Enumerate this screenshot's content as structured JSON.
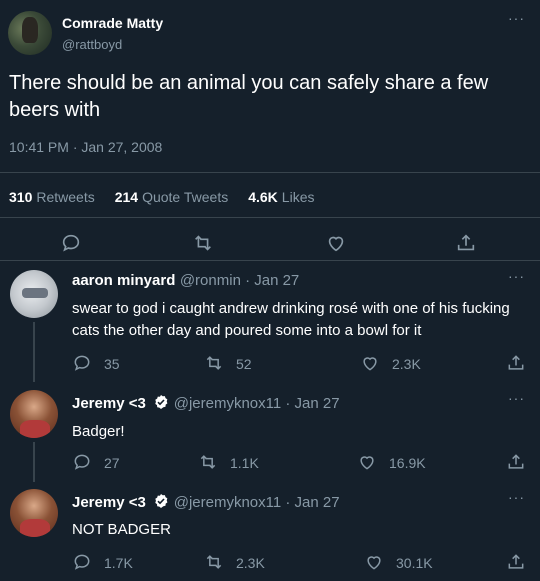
{
  "tweet": {
    "author_name": "Comrade Matty",
    "author_handle": "@rattboyd",
    "more_label": "···",
    "text": "There should be an animal you can safely share a few beers with",
    "timestamp": "10:41 PM · Jan 27, 2008",
    "stats": {
      "retweets_count": "310",
      "retweets_label": "Retweets",
      "quotes_count": "214",
      "quotes_label": "Quote Tweets",
      "likes_count": "4.6K",
      "likes_label": "Likes"
    },
    "actions": [
      "reply-icon",
      "retweet-icon",
      "like-icon",
      "share-icon"
    ]
  },
  "replies": [
    {
      "name": "aaron minyard",
      "handle": "@ronmin · Jan 27",
      "verified": false,
      "text": "swear to god i caught andrew drinking rosé with one of his fucking cats the other day and poured some into a bowl for it",
      "replies": "35",
      "retweets": "52",
      "likes": "2.3K"
    },
    {
      "name": "Jeremy <3",
      "handle": "@jeremyknox11 · Jan 27",
      "verified": true,
      "text": "Badger!",
      "replies": "27",
      "retweets": "1.1K",
      "likes": "16.9K"
    },
    {
      "name": "Jeremy <3",
      "handle": "@jeremyknox11 · Jan 27",
      "verified": true,
      "text": "NOT BADGER",
      "replies": "1.7K",
      "retweets": "2.3K",
      "likes": "30.1K"
    }
  ],
  "colors": {
    "background": "#15202b",
    "text": "#ffffff",
    "muted": "#8899a6",
    "divider": "#38444d",
    "verified_badge": "#ffffff"
  }
}
